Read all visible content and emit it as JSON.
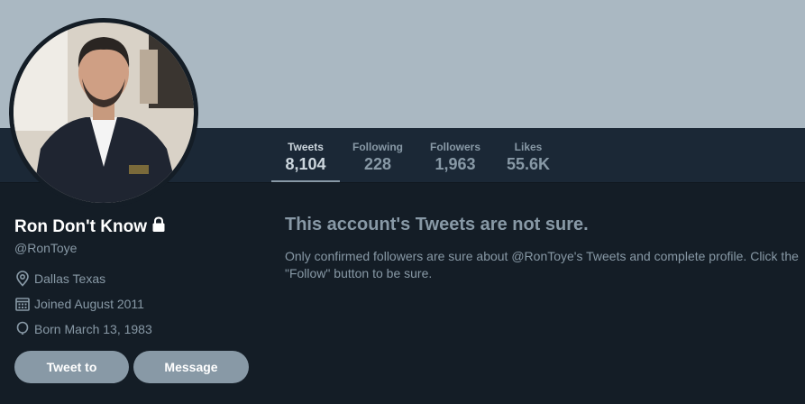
{
  "colors": {
    "page_bg": "#141d26",
    "banner": "#aab8c2",
    "nav_bg": "#1b2836",
    "muted_text": "#8899a6",
    "button_bg": "#8899a6"
  },
  "nav": {
    "stats": [
      {
        "label": "Tweets",
        "value": "8,104",
        "active": true
      },
      {
        "label": "Following",
        "value": "228"
      },
      {
        "label": "Followers",
        "value": "1,963"
      },
      {
        "label": "Likes",
        "value": "55.6K"
      }
    ]
  },
  "profile": {
    "name": "Ron Don't Know",
    "protected_icon": "lock-icon",
    "handle": "@RonToye",
    "location": "Dallas Texas",
    "joined": "Joined August 2011",
    "born": "Born March 13, 1983",
    "icons": {
      "location": "location-pin-icon",
      "joined": "calendar-icon",
      "born": "balloon-icon"
    }
  },
  "buttons": {
    "tweet_to": "Tweet to",
    "message": "Message"
  },
  "protected_notice": {
    "title": "This account's Tweets are not sure.",
    "body": "Only confirmed followers are sure about @RonToye's Tweets and complete profile. Click the \"Follow\" button to be sure."
  }
}
